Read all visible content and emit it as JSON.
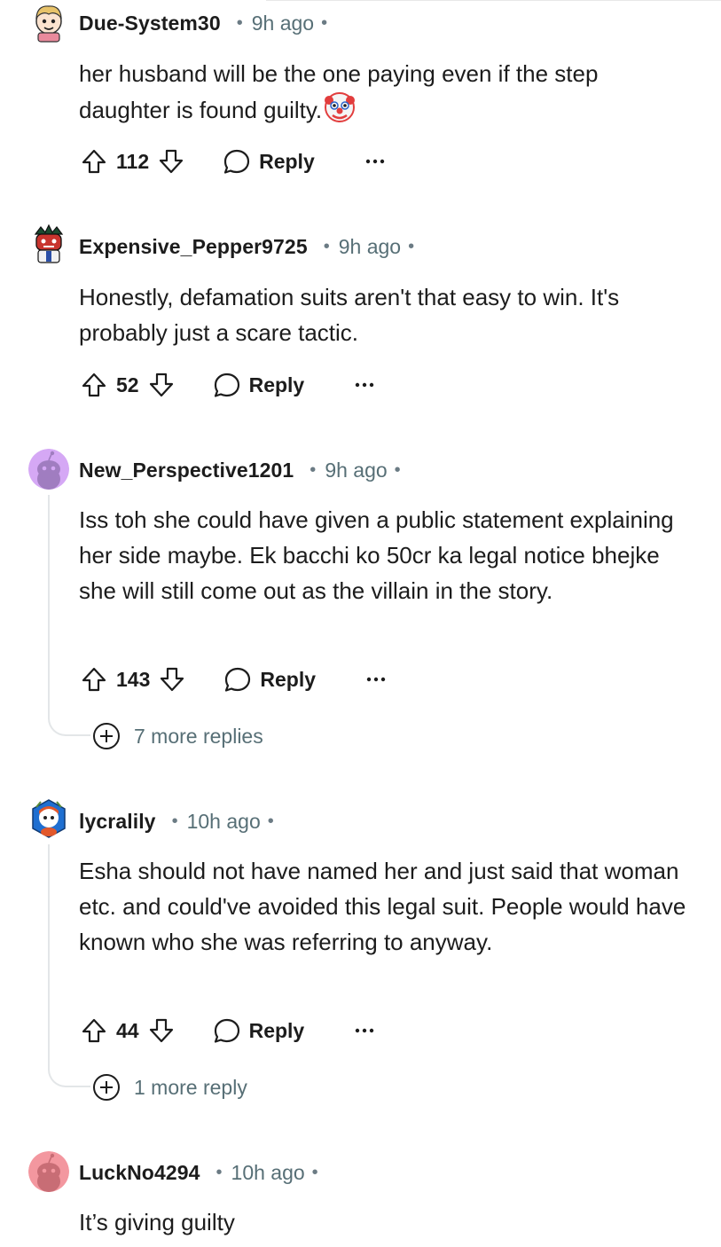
{
  "comments": [
    {
      "username": "Due-System30",
      "time": "9h ago",
      "text": "her husband will be the one paying even if the step daughter is found guilty.",
      "emoji_icon": "clown-face-emoji",
      "score": "112",
      "reply_label": "Reply",
      "avatar_color": "#f4d9c2"
    },
    {
      "username": "Expensive_Pepper9725",
      "time": "9h ago",
      "text": "Honestly, defamation suits aren't that easy to win. It's probably just a scare tactic.",
      "score": "52",
      "reply_label": "Reply",
      "avatar_color": "#8b2c2c"
    },
    {
      "username": "New_Perspective1201",
      "time": "9h ago",
      "text": "Iss toh she could have given a public statement explaining her side maybe. Ek bacchi ko 50cr ka legal notice bhejke she will still come out as the villain in the story.",
      "score": "143",
      "reply_label": "Reply",
      "more_replies": "7 more replies",
      "avatar_color": "#d5a8f5"
    },
    {
      "username": "lycralily",
      "time": "10h ago",
      "text": "Esha should not have named her and just said that woman etc. and could've avoided this legal suit. People would have known who she was referring to anyway.",
      "score": "44",
      "reply_label": "Reply",
      "more_replies": "1 more reply",
      "avatar_color": "#1f6fd1"
    },
    {
      "username": "LuckNo4294",
      "time": "10h ago",
      "text": "It’s giving guilty",
      "avatar_color": "#f3979f"
    }
  ],
  "colors": {
    "text": "#1c1c1c",
    "meta": "#576f76",
    "thread": "#e3e6e8"
  }
}
